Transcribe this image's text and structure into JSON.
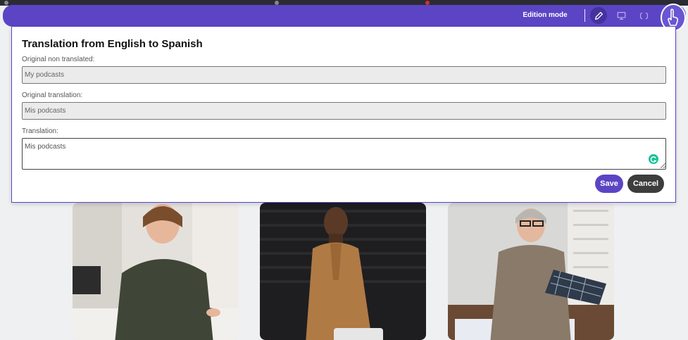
{
  "toolbar": {
    "mode_label": "Edition mode",
    "tools": [
      {
        "name": "pencil-icon",
        "active": true
      },
      {
        "name": "monitor-icon",
        "active": false
      },
      {
        "name": "code-brackets-icon",
        "active": false
      }
    ],
    "accent": "#5b45c4"
  },
  "modal": {
    "title": "Translation from English to Spanish",
    "original_label": "Original non translated:",
    "original_value": "My podcasts",
    "original_translation_label": "Original translation:",
    "original_translation_value": "Mis podcasts",
    "translation_label": "Translation:",
    "translation_value": "Mis podcasts",
    "save_label": "Save",
    "cancel_label": "Cancel"
  },
  "cards": [
    {
      "name": "photo-card-woman-workshop"
    },
    {
      "name": "photo-card-man-coat"
    },
    {
      "name": "photo-card-woman-glasses"
    }
  ]
}
